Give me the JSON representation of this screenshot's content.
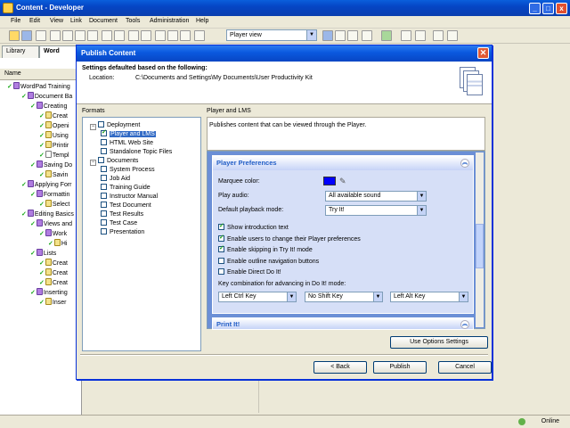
{
  "window": {
    "title": "Content - Developer",
    "min": "_",
    "max": "□",
    "close": "x"
  },
  "menu": [
    "File",
    "Edit",
    "View",
    "Link",
    "Document",
    "Tools",
    "Administration",
    "Help"
  ],
  "toolbar": {
    "view_combo": "Player view"
  },
  "tabs": [
    "Library",
    "Word"
  ],
  "tree": {
    "header": "Name",
    "items": [
      {
        "label": "WordPad Training",
        "type": "book"
      },
      {
        "label": "Document Ba",
        "type": "book"
      },
      {
        "label": "Creating",
        "type": "book"
      },
      {
        "label": "Creat",
        "type": "page"
      },
      {
        "label": "Openi",
        "type": "page"
      },
      {
        "label": "Using",
        "type": "page"
      },
      {
        "label": "Printir",
        "type": "page"
      },
      {
        "label": "Templ",
        "type": "doc"
      },
      {
        "label": "Saving Do",
        "type": "book"
      },
      {
        "label": "Savin",
        "type": "page"
      },
      {
        "label": "Applying Forr",
        "type": "book"
      },
      {
        "label": "Formattin",
        "type": "book"
      },
      {
        "label": "Select",
        "type": "page"
      },
      {
        "label": "Editing Basics",
        "type": "book"
      },
      {
        "label": "Views and",
        "type": "book"
      },
      {
        "label": "Work",
        "type": "book"
      },
      {
        "label": "Hi",
        "type": "page"
      },
      {
        "label": "Lists",
        "type": "book"
      },
      {
        "label": "Creat",
        "type": "page"
      },
      {
        "label": "Creat",
        "type": "page"
      },
      {
        "label": "Creat",
        "type": "page"
      },
      {
        "label": "Inserting",
        "type": "book"
      },
      {
        "label": "Inser",
        "type": "page"
      }
    ]
  },
  "status": {
    "online": "Online"
  },
  "dialog": {
    "title": "Publish Content",
    "heading": "Settings defaulted based on the following:",
    "location_label": "Location:",
    "location_value": "C:\\Documents and Settings\\My Documents\\User Productivity Kit",
    "formats_header": "Formats",
    "formats": [
      {
        "label": "Deployment",
        "checked": false,
        "group": true
      },
      {
        "label": "Player and LMS",
        "checked": true,
        "selected": true
      },
      {
        "label": "HTML Web Site",
        "checked": false
      },
      {
        "label": "Standalone Topic Files",
        "checked": false
      },
      {
        "label": "Documents",
        "checked": false,
        "group": true
      },
      {
        "label": "System Process",
        "checked": false
      },
      {
        "label": "Job Aid",
        "checked": false
      },
      {
        "label": "Training Guide",
        "checked": false
      },
      {
        "label": "Instructor Manual",
        "checked": false
      },
      {
        "label": "Test Document",
        "checked": false
      },
      {
        "label": "Test Results",
        "checked": false
      },
      {
        "label": "Test Case",
        "checked": false
      },
      {
        "label": "Presentation",
        "checked": false
      }
    ],
    "right_header": "Player and LMS",
    "description": "Publishes content that can be viewed through the Player.",
    "player_prefs": {
      "title": "Player Preferences",
      "marquee_color_label": "Marquee color:",
      "marquee_color": "#0000ff",
      "play_audio_label": "Play audio:",
      "play_audio_value": "All available sound",
      "playback_label": "Default playback mode:",
      "playback_value": "Try It!",
      "options": [
        {
          "label": "Show introduction text",
          "checked": true
        },
        {
          "label": "Enable users to change their Player preferences",
          "checked": true
        },
        {
          "label": "Enable skipping in Try It! mode",
          "checked": true
        },
        {
          "label": "Enable outline navigation buttons",
          "checked": false
        },
        {
          "label": "Enable Direct Do It!",
          "checked": false
        }
      ],
      "key_combo_label": "Key combination for advancing in Do It! mode:",
      "keys": [
        "Left Ctrl Key",
        "No Shift Key",
        "Left Alt Key"
      ]
    },
    "print_panel": "Print It!",
    "use_options_button": "Use Options Settings",
    "back_button": "< Back",
    "publish_button": "Publish",
    "cancel_button": "Cancel"
  }
}
